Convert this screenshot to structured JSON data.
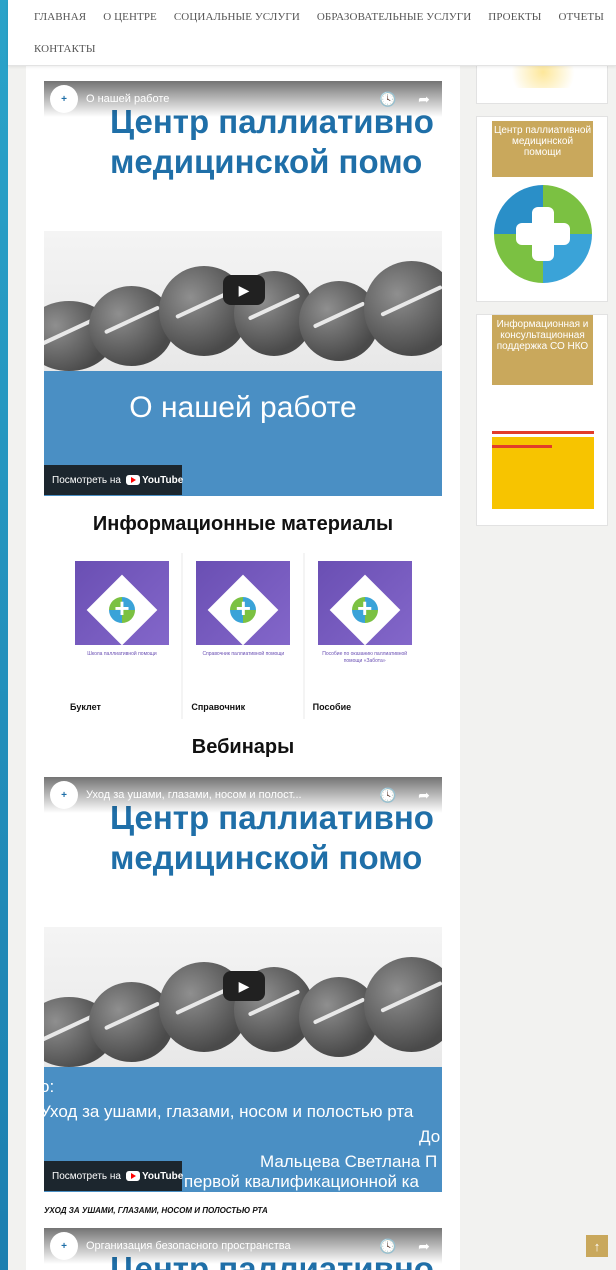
{
  "nav": {
    "items": [
      "ГЛАВНАЯ",
      "О ЦЕНТРЕ",
      "СОЦИАЛЬНЫЕ УСЛУГИ",
      "ОБРАЗОВАТЕЛЬНЫЕ УСЛУГИ",
      "ПРОЕКТЫ",
      "ОТЧЕТЫ"
    ],
    "contacts": "КОНТАКТЫ"
  },
  "video1": {
    "title": "О нашей работе",
    "brand_line1": "Центр паллиативно",
    "brand_line2": "медицинской помо",
    "caption": "О нашей работе",
    "watch_label": "Посмотреть на",
    "youtube_label": "YouTube",
    "actions": [
      "Смотреть...",
      "Поделиться"
    ]
  },
  "info_materials": {
    "heading": "Информационные материалы",
    "cards": [
      {
        "label": "Буклет",
        "cover_text": "Школа паллиативной помощи"
      },
      {
        "label": "Справочник",
        "cover_text": "Справочник паллиативной помощи"
      },
      {
        "label": "Пособие",
        "cover_text": "Пособие по оказанию паллиативной помощи «Забота»"
      }
    ]
  },
  "webinars": {
    "heading": "Вебинары"
  },
  "video2": {
    "title": "Уход за ушами, глазами, носом и полост...",
    "brand_line1": "Центр паллиативно",
    "brand_line2": "медицинской помо",
    "subtitle_1": "Уход за ушами, глазами, носом и полостью рта",
    "subtitle_2": "До",
    "subtitle_3": "Мальцева Светлана П",
    "subtitle_4": "первой квалификационной ка",
    "watch_label": "Посмотреть на",
    "youtube_label": "YouTube",
    "caption": "УХОД ЗА УШАМИ, ГЛАЗАМИ, НОСОМ И ПОЛОСТЬЮ РТА"
  },
  "video3": {
    "title": "Организация безопасного пространства",
    "brand_line1": "Центр паллиативно"
  },
  "sidebar": {
    "widget1_title": "Центр паллиативной медицинской помощи",
    "widget2_title": "Информационная и консультационная поддержка СО НКО"
  },
  "colors": {
    "accent_gold": "#c9a85c",
    "brand_blue": "#1f6fa8",
    "brand_green": "#7bc142",
    "stripe": "#2aa3c9"
  }
}
